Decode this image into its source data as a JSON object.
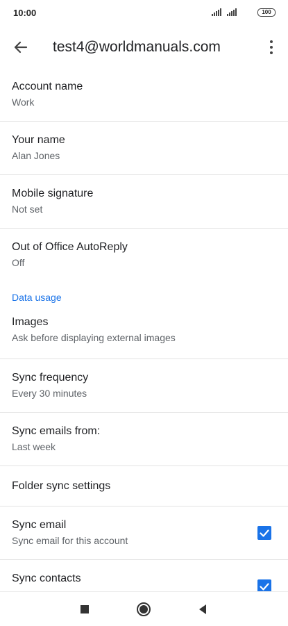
{
  "status_bar": {
    "time": "10:00",
    "battery": "100",
    "icons": [
      "signal-icon",
      "signal-icon",
      "battery-icon"
    ]
  },
  "app_bar": {
    "title": "test4@worldmanuals.com",
    "icons": [
      "back-arrow-icon",
      "more-vert-icon"
    ]
  },
  "settings": {
    "items": [
      {
        "title": "Account name",
        "subtitle": "Work"
      },
      {
        "title": "Your name",
        "subtitle": "Alan Jones"
      },
      {
        "title": "Mobile signature",
        "subtitle": "Not set"
      },
      {
        "title": "Out of Office AutoReply",
        "subtitle": "Off"
      }
    ],
    "section_label": "Data usage",
    "data_items": [
      {
        "title": "Images",
        "subtitle": "Ask before displaying external images"
      },
      {
        "title": "Sync frequency",
        "subtitle": "Every 30 minutes"
      },
      {
        "title": "Sync emails from:",
        "subtitle": "Last week"
      },
      {
        "title": "Folder sync settings"
      },
      {
        "title": "Sync email",
        "subtitle": "Sync email for this account",
        "checked": true
      },
      {
        "title": "Sync contacts",
        "checked": true
      }
    ]
  },
  "nav_bar": {
    "icons": [
      "recents-square-icon",
      "home-circle-icon",
      "back-triangle-icon"
    ]
  },
  "colors": {
    "accent": "#1a73e8",
    "text_primary": "#202124",
    "text_secondary": "#5f6368",
    "divider": "#e3e3e3"
  }
}
